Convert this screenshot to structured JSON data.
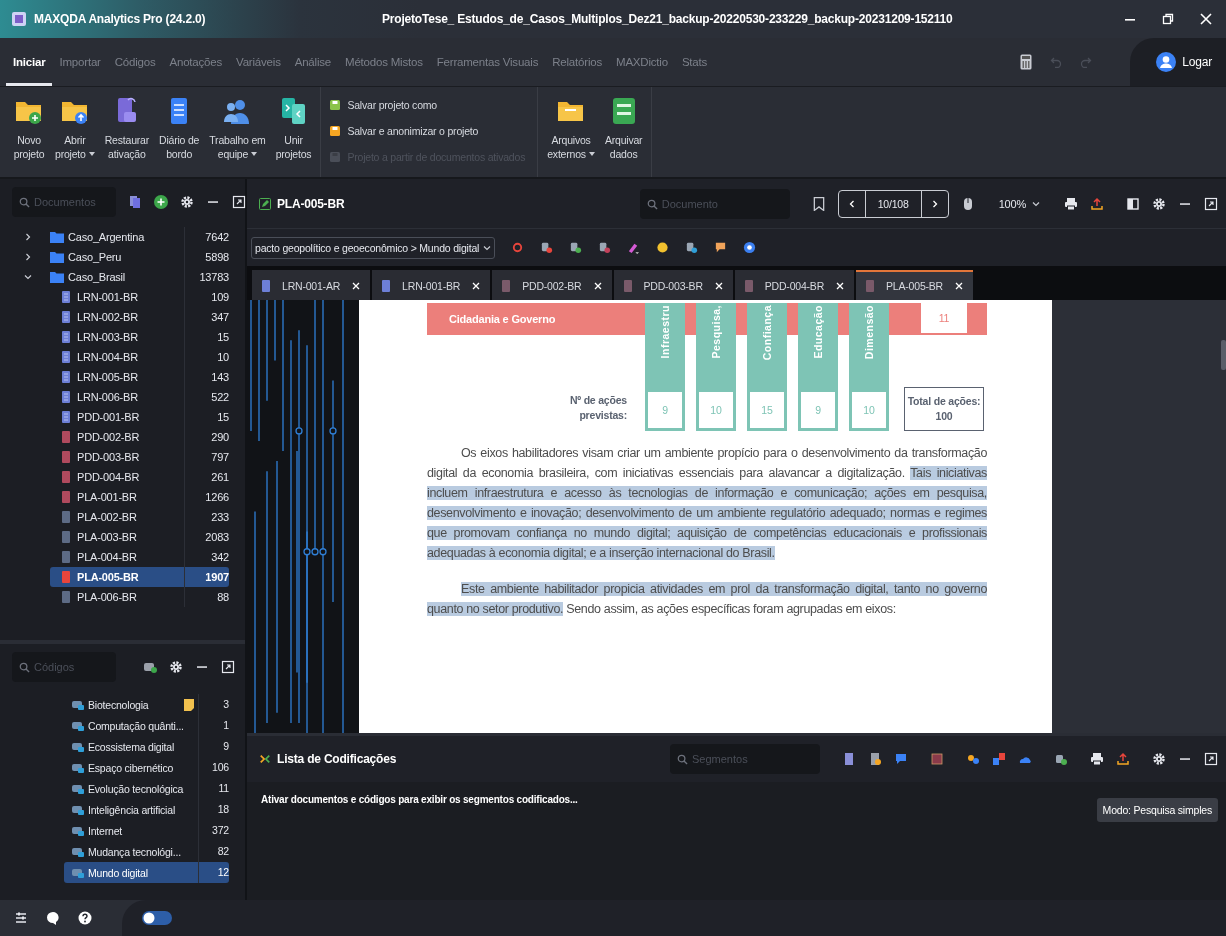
{
  "title_bar": {
    "app_name": "MAXQDA Analytics Pro (24.2.0)",
    "project": "ProjetoTese_ Estudos_de_Casos_Multiplos_Dez21_backup-20220530-233229_backup-20231209-152110"
  },
  "menu_tabs": [
    {
      "label": "Iniciar",
      "selected": true
    },
    {
      "label": "Importar",
      "selected": false
    },
    {
      "label": "Códigos",
      "selected": false
    },
    {
      "label": "Anotações",
      "selected": false
    },
    {
      "label": "Variáveis",
      "selected": false
    },
    {
      "label": "Análise",
      "selected": false
    },
    {
      "label": "Métodos Mistos",
      "selected": false
    },
    {
      "label": "Ferramentas Visuais",
      "selected": false
    },
    {
      "label": "Relatórios",
      "selected": false
    },
    {
      "label": "MAXDictio",
      "selected": false
    },
    {
      "label": "Stats",
      "selected": false
    }
  ],
  "undo": {
    "disabled": true
  },
  "redo": {
    "disabled": true
  },
  "account": {
    "label": "Logar"
  },
  "ribbon": {
    "groups": [
      {
        "kind": "large",
        "items": [
          {
            "lines": [
              "Novo",
              "projeto"
            ],
            "dropdown": false
          },
          {
            "lines": [
              "Abrir",
              "projeto"
            ],
            "dropdown": true
          },
          {
            "lines": [
              "Restaurar",
              "ativação"
            ],
            "dropdown": false
          },
          {
            "lines": [
              "Diário de",
              "bordo"
            ],
            "dropdown": false
          },
          {
            "lines": [
              "Trabalho em",
              "equipe"
            ],
            "dropdown": true
          },
          {
            "lines": [
              "Unir",
              "projetos"
            ],
            "dropdown": false
          }
        ]
      },
      {
        "kind": "list",
        "items": [
          {
            "label": "Salvar projeto como",
            "disabled": false
          },
          {
            "label": "Salvar e anonimizar o projeto",
            "disabled": false
          },
          {
            "label": "Projeto a partir de documentos ativados",
            "disabled": true
          }
        ]
      },
      {
        "kind": "large",
        "items": [
          {
            "lines": [
              "Arquivos",
              "externos"
            ],
            "dropdown": true
          },
          {
            "lines": [
              "Arquivar",
              "dados"
            ],
            "dropdown": false
          }
        ]
      }
    ]
  },
  "documents": {
    "search_placeholder": "Documentos",
    "tree": [
      {
        "name": "Caso_Argentina",
        "count": "7642",
        "expanded": false
      },
      {
        "name": "Caso_Peru",
        "count": "5898",
        "expanded": false
      },
      {
        "name": "Caso_Brasil",
        "count": "13783",
        "expanded": true,
        "children": [
          {
            "name": "LRN-001-BR",
            "count": "109",
            "kind": "text",
            "selected": false
          },
          {
            "name": "LRN-002-BR",
            "count": "347",
            "kind": "text",
            "selected": false
          },
          {
            "name": "LRN-003-BR",
            "count": "15",
            "kind": "text",
            "selected": false
          },
          {
            "name": "LRN-004-BR",
            "count": "10",
            "kind": "text",
            "selected": false
          },
          {
            "name": "LRN-005-BR",
            "count": "143",
            "kind": "text",
            "selected": false
          },
          {
            "name": "LRN-006-BR",
            "count": "522",
            "kind": "text",
            "selected": false
          },
          {
            "name": "PDD-001-BR",
            "count": "15",
            "kind": "text",
            "selected": false
          },
          {
            "name": "PDD-002-BR",
            "count": "290",
            "kind": "pdf",
            "selected": false
          },
          {
            "name": "PDD-003-BR",
            "count": "797",
            "kind": "pdf",
            "selected": false
          },
          {
            "name": "PDD-004-BR",
            "count": "261",
            "kind": "pdf",
            "selected": false
          },
          {
            "name": "PLA-001-BR",
            "count": "1266",
            "kind": "pdf",
            "selected": false
          },
          {
            "name": "PLA-002-BR",
            "count": "233",
            "kind": "other",
            "selected": false
          },
          {
            "name": "PLA-003-BR",
            "count": "2083",
            "kind": "other",
            "selected": false
          },
          {
            "name": "PLA-004-BR",
            "count": "342",
            "kind": "other",
            "selected": false
          },
          {
            "name": "PLA-005-BR",
            "count": "1907",
            "kind": "pdf",
            "selected": true
          },
          {
            "name": "PLA-006-BR",
            "count": "88",
            "kind": "other",
            "selected": false
          }
        ]
      }
    ]
  },
  "codes": {
    "search_placeholder": "Códigos",
    "items": [
      {
        "name": "Biotecnologia",
        "count": "3",
        "memo": true,
        "selected": false
      },
      {
        "name": "Computação quânti...",
        "count": "1",
        "memo": false,
        "selected": false
      },
      {
        "name": "Ecossistema digital",
        "count": "9",
        "memo": false,
        "selected": false
      },
      {
        "name": "Espaço cibernético",
        "count": "106",
        "memo": false,
        "selected": false
      },
      {
        "name": "Evolução tecnológica",
        "count": "11",
        "memo": false,
        "selected": false
      },
      {
        "name": "Inteligência artificial",
        "count": "18",
        "memo": false,
        "selected": false
      },
      {
        "name": "Internet",
        "count": "372",
        "memo": false,
        "selected": false
      },
      {
        "name": "Mudança tecnológi...",
        "count": "82",
        "memo": false,
        "selected": false
      },
      {
        "name": "Mundo digital",
        "count": "12",
        "memo": false,
        "selected": true
      }
    ]
  },
  "document_browser": {
    "title": "PLA-005-BR",
    "search_placeholder": "Documento",
    "page": "10/108",
    "zoom": "100%",
    "code_path": "pacto geopolítico e geoeconômico > Mundo digital",
    "tabs": [
      {
        "label": "LRN-001-AR",
        "kind": "text",
        "selected": false
      },
      {
        "label": "LRN-001-BR",
        "kind": "text",
        "selected": false
      },
      {
        "label": "PDD-002-BR",
        "kind": "pdf",
        "selected": false
      },
      {
        "label": "PDD-003-BR",
        "kind": "pdf",
        "selected": false
      },
      {
        "label": "PDD-004-BR",
        "kind": "pdf",
        "selected": false
      },
      {
        "label": "PLA-005-BR",
        "kind": "pdf",
        "selected": true
      }
    ],
    "table": {
      "row_label": "Cidadania e Governo",
      "row_total": "11",
      "count_label": [
        "Nº de ações",
        "previstas:"
      ],
      "total_label": [
        "Total de ações:",
        "100"
      ],
      "columns": [
        {
          "header": "Infraestru",
          "count": "9"
        },
        {
          "header": "Pesquisa,",
          "count": "10"
        },
        {
          "header": "Confiança",
          "count": "15"
        },
        {
          "header": "Educação",
          "count": "9"
        },
        {
          "header": "Dimensão",
          "count": "10"
        }
      ]
    },
    "paragraphs": [
      {
        "segments": [
          {
            "text": "Os eixos habilitadores visam criar um ambiente propício para o desenvolvimento da transformação digital da economia brasileira, com iniciativas essenciais para alavancar a digitalização.",
            "highlighted": false
          },
          {
            "text": "Tais iniciativas incluem infraestrutura e acesso às tecnologias de informação e comunicação; ações em pesquisa, desenvolvimento e inovação; desenvolvimento de um ambiente regulatório adequado; normas e regimes que promovam confiança no mundo digital; aquisição de competências educacionais e profissionais adequadas à economia digital; e a inserção internacional do Brasil.",
            "highlighted": true
          }
        ]
      },
      {
        "segments": [
          {
            "text": "Este ambiente habilitador propicia atividades em prol da transformação digital, tanto no governo quanto no setor produtivo.",
            "highlighted": true
          },
          {
            "text": "Sendo assim, as ações específicas foram agrupadas em eixos:",
            "highlighted": false
          }
        ]
      }
    ]
  },
  "theme_toggle": {
    "on": false
  },
  "coded_segments": {
    "title": "Lista de Codificações",
    "search_placeholder": "Segmentos",
    "message": "Ativar documentos e códigos para exibir os segmentos codificados...",
    "mode_button": "Modo: Pesquisa simples"
  }
}
